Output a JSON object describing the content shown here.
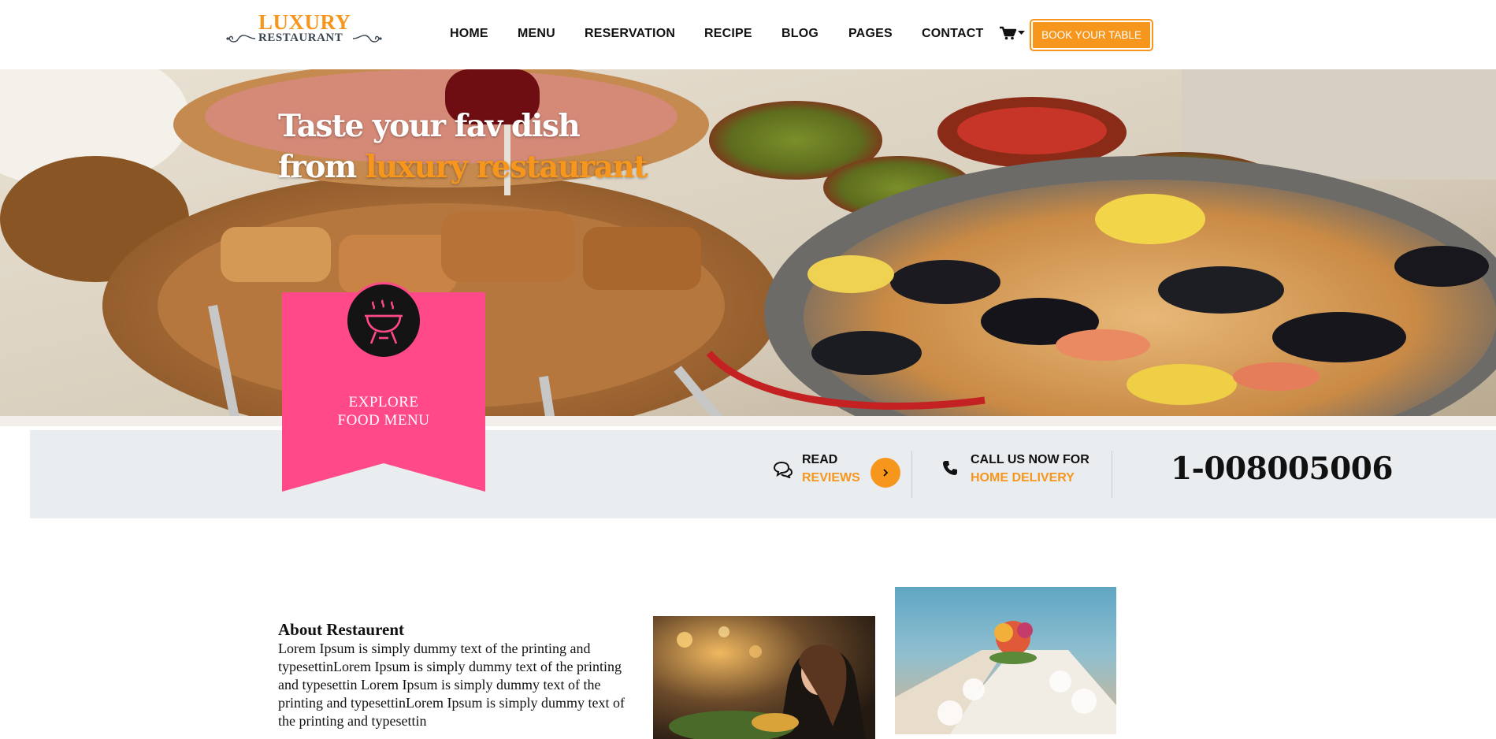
{
  "brand": {
    "name_top": "LUXURY",
    "name_bottom": "RESTAURANT",
    "accent_color": "#f7961d",
    "ribbon_color": "#ff4988"
  },
  "nav": {
    "items": [
      {
        "label": "HOME"
      },
      {
        "label": "MENU"
      },
      {
        "label": "RESERVATION"
      },
      {
        "label": "RECIPE"
      },
      {
        "label": "BLOG"
      },
      {
        "label": "PAGES"
      },
      {
        "label": "CONTACT"
      }
    ],
    "cart_icon": "shopping-cart-icon",
    "book_button": "BOOK YOUR TABLE"
  },
  "hero": {
    "line1": "Taste your fav dish",
    "line2_prefix": "from ",
    "line2_accent": "luxury restaurant"
  },
  "ribbon": {
    "icon": "grill-icon",
    "line1": "EXPLORE",
    "line2": "FOOD MENU"
  },
  "strip": {
    "reviews": {
      "icon": "chat-bubbles-icon",
      "line1": "READ",
      "line2": "REVIEWS",
      "button_icon": "chevron-right-icon"
    },
    "delivery": {
      "icon": "phone-icon",
      "line1": "CALL US NOW FOR",
      "line2": "HOME DELIVERY"
    },
    "phone": "1-008005006"
  },
  "about": {
    "title": "About Restaurent",
    "text": "Lorem Ipsum is simply dummy text of the printing and typesettinLorem Ipsum is simply dummy text of the printing and typesettin Lorem Ipsum is simply dummy text of the printing and typesettinLorem Ipsum is simply dummy text of the printing and typesettin"
  }
}
